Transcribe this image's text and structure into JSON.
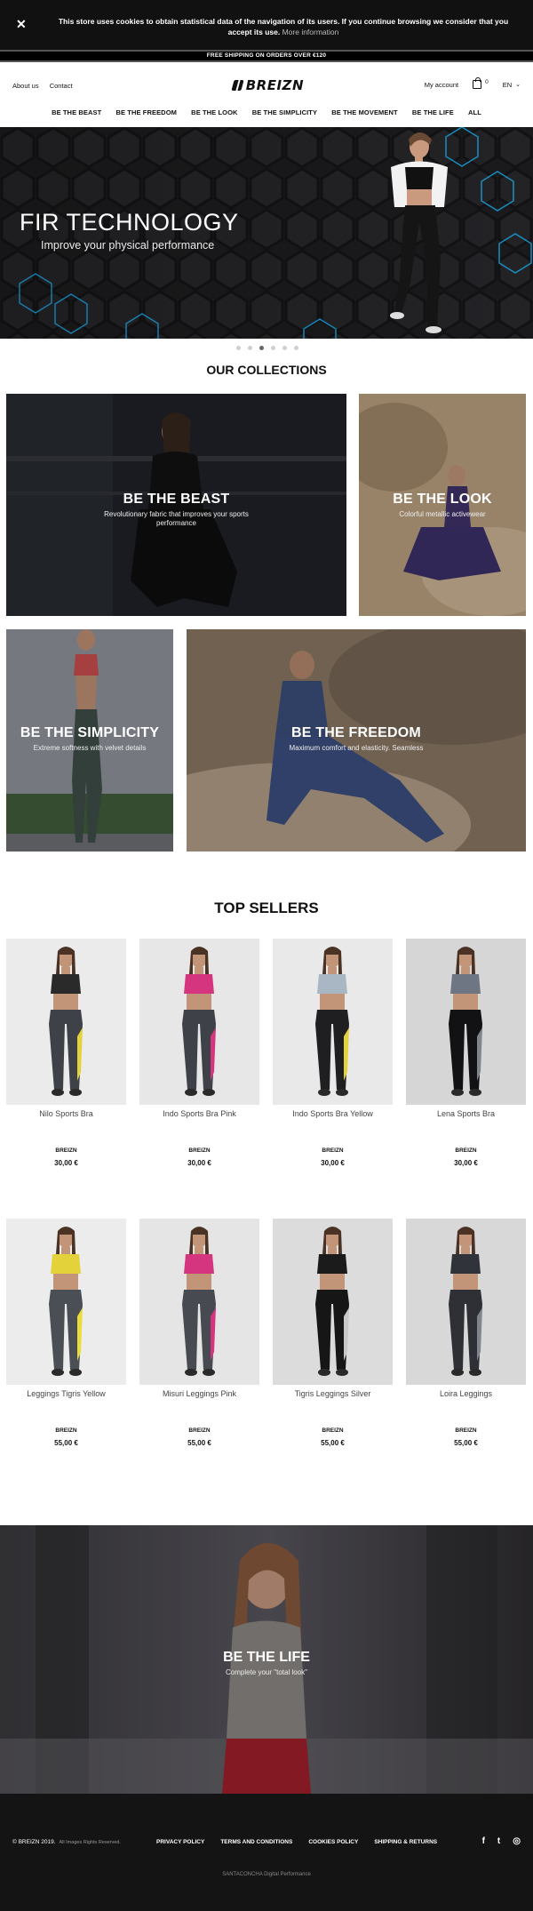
{
  "cookie": {
    "close_icon": "close-icon",
    "message": "This store uses cookies to obtain statistical data of the navigation of its users. If you continue browsing we consider that you accept its use.",
    "link": "More information"
  },
  "shipping": "FREE SHIPPING ON ORDERS OVER €120",
  "header": {
    "about": "About us",
    "contact": "Contact",
    "logo": "BREIZN",
    "account": "My account",
    "cart_count": "0",
    "language": "EN"
  },
  "nav": [
    "BE THE BEAST",
    "BE THE FREEDOM",
    "BE THE LOOK",
    "BE THE SIMPLICITY",
    "BE THE MOVEMENT",
    "BE THE LIFE",
    "ALL"
  ],
  "hero": {
    "title": "FIR TECHNOLOGY",
    "subtitle": "Improve your physical performance",
    "slides": 6,
    "active_slide": 3
  },
  "collections": {
    "title": "OUR COLLECTIONS",
    "items": [
      {
        "title": "BE THE BEAST",
        "subtitle": "Revolutionary fabric that improves your sports performance"
      },
      {
        "title": "BE THE LOOK",
        "subtitle": "Colorful metallic activewear"
      },
      {
        "title": "BE THE SIMPLICITY",
        "subtitle": "Extreme softness with velvet details"
      },
      {
        "title": "BE THE FREEDOM",
        "subtitle": "Maximum comfort and elasticity. Seamless"
      }
    ]
  },
  "top_sellers": {
    "title": "TOP SELLERS",
    "products": [
      {
        "name": "Nilo Sports Bra",
        "brand": "BREIZN",
        "price": "30,00 €"
      },
      {
        "name": "Indo Sports Bra Pink",
        "brand": "BREIZN",
        "price": "30,00 €"
      },
      {
        "name": "Indo Sports Bra Yellow",
        "brand": "BREIZN",
        "price": "30,00 €"
      },
      {
        "name": "Lena Sports Bra",
        "brand": "BREIZN",
        "price": "30,00 €"
      },
      {
        "name": "Leggings Tigris Yellow",
        "brand": "BREIZN",
        "price": "55,00 €"
      },
      {
        "name": "Misuri Leggings Pink",
        "brand": "BREIZN",
        "price": "55,00 €"
      },
      {
        "name": "Tigris Leggings Silver",
        "brand": "BREIZN",
        "price": "55,00 €"
      },
      {
        "name": "Loira Leggings",
        "brand": "BREIZN",
        "price": "55,00 €"
      }
    ]
  },
  "life": {
    "title": "BE THE LIFE",
    "subtitle": "Complete your \"total look\""
  },
  "footer": {
    "copyright": "© BREIZN 2019.",
    "rights": "All Images Rights Reserved.",
    "links": [
      "PRIVACY POLICY",
      "TERMS AND CONDITIONS",
      "COOKIES POLICY",
      "SHIPPING & RETURNS"
    ],
    "social": [
      {
        "icon": "facebook-icon",
        "glyph": "f"
      },
      {
        "icon": "twitter-icon",
        "glyph": "t"
      },
      {
        "icon": "instagram-icon",
        "glyph": "◎"
      }
    ],
    "credits": "SANTACONCHA Digital Performance"
  },
  "colors": {
    "accent_blue": "#1aa3e0",
    "dark": "#111111"
  }
}
